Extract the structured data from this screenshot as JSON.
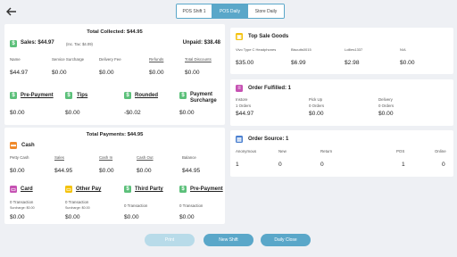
{
  "tabs": [
    "POS Shift 1",
    "POS Daily",
    "Store Daily"
  ],
  "sales_card": {
    "total_collected": "Total Collected: $44.95",
    "sales_label": "Sales: $44.97",
    "tax_note": "(Inc. Tax: $4.09)",
    "unpaid": "Unpaid: $38.48",
    "cols": [
      {
        "label": "Name",
        "value": "$44.97"
      },
      {
        "label": "Service Surcharge",
        "value": "$0.00"
      },
      {
        "label": "Delivery Fee",
        "value": "$0.00"
      },
      {
        "label": "Refunds",
        "value": "$0.00"
      },
      {
        "label": "Total Discounts",
        "value": "$0.00"
      }
    ],
    "extras": [
      {
        "label": "Pre-Payment",
        "value": "$0.00"
      },
      {
        "label": "Tips",
        "value": "$0.00"
      },
      {
        "label": "Rounded",
        "value": "-$0.02"
      },
      {
        "label": "Payment Surcharge",
        "value": "$0.00"
      }
    ]
  },
  "payments_card": {
    "total_payments": "Total Payments: $44.95",
    "cash_label": "Cash",
    "cols": [
      {
        "label": "Petty Cash",
        "value": "$0.00"
      },
      {
        "label": "Sales",
        "value": "$44.95"
      },
      {
        "label": "Cash In",
        "value": "$0.00"
      },
      {
        "label": "Cash Out",
        "value": "$0.00"
      },
      {
        "label": "Balance",
        "value": "$44.95"
      }
    ],
    "methods": [
      {
        "label": "Card",
        "tx": "0 Transaction",
        "surcharge": "Surcharge: $0.00",
        "value": "$0.00"
      },
      {
        "label": "Other Pay",
        "tx": "0 Transaction",
        "surcharge": "Surcharge: $0.00",
        "value": "$0.00"
      },
      {
        "label": "Third Party",
        "tx": "0 Transaction",
        "value": "$0.00"
      },
      {
        "label": "Pre-Payment",
        "tx": "0 Transaction",
        "value": "$0.00"
      }
    ]
  },
  "top_sale": {
    "title": "Top Sale Goods",
    "items": [
      {
        "name": "Vivo Type C Headphones",
        "value": "$35.00"
      },
      {
        "name": "Biscuits0015",
        "value": "$6.99"
      },
      {
        "name": "Lollies1337",
        "value": "$2.98"
      },
      {
        "name": "N/A",
        "value": "$0.00"
      }
    ]
  },
  "fulfilled": {
    "title": "Order Fulfilled: 1",
    "cols": [
      {
        "label": "Instore",
        "orders": "1 Orders",
        "value": "$44.97"
      },
      {
        "label": "Pick Up",
        "orders": "0 Orders",
        "value": "$0.00"
      },
      {
        "label": "Delivery",
        "orders": "0 Orders",
        "value": "$0.00"
      }
    ]
  },
  "source": {
    "title": "Order Source: 1",
    "cols": [
      {
        "label": "Anonymous",
        "value": "1"
      },
      {
        "label": "New",
        "value": "0"
      },
      {
        "label": "Return",
        "value": "0"
      },
      {
        "label": "POS",
        "value": "1"
      },
      {
        "label": "Online",
        "value": "0"
      }
    ]
  },
  "buttons": {
    "print": "Print",
    "new_shift": "New Shift",
    "daily_close": "Daily Close"
  }
}
